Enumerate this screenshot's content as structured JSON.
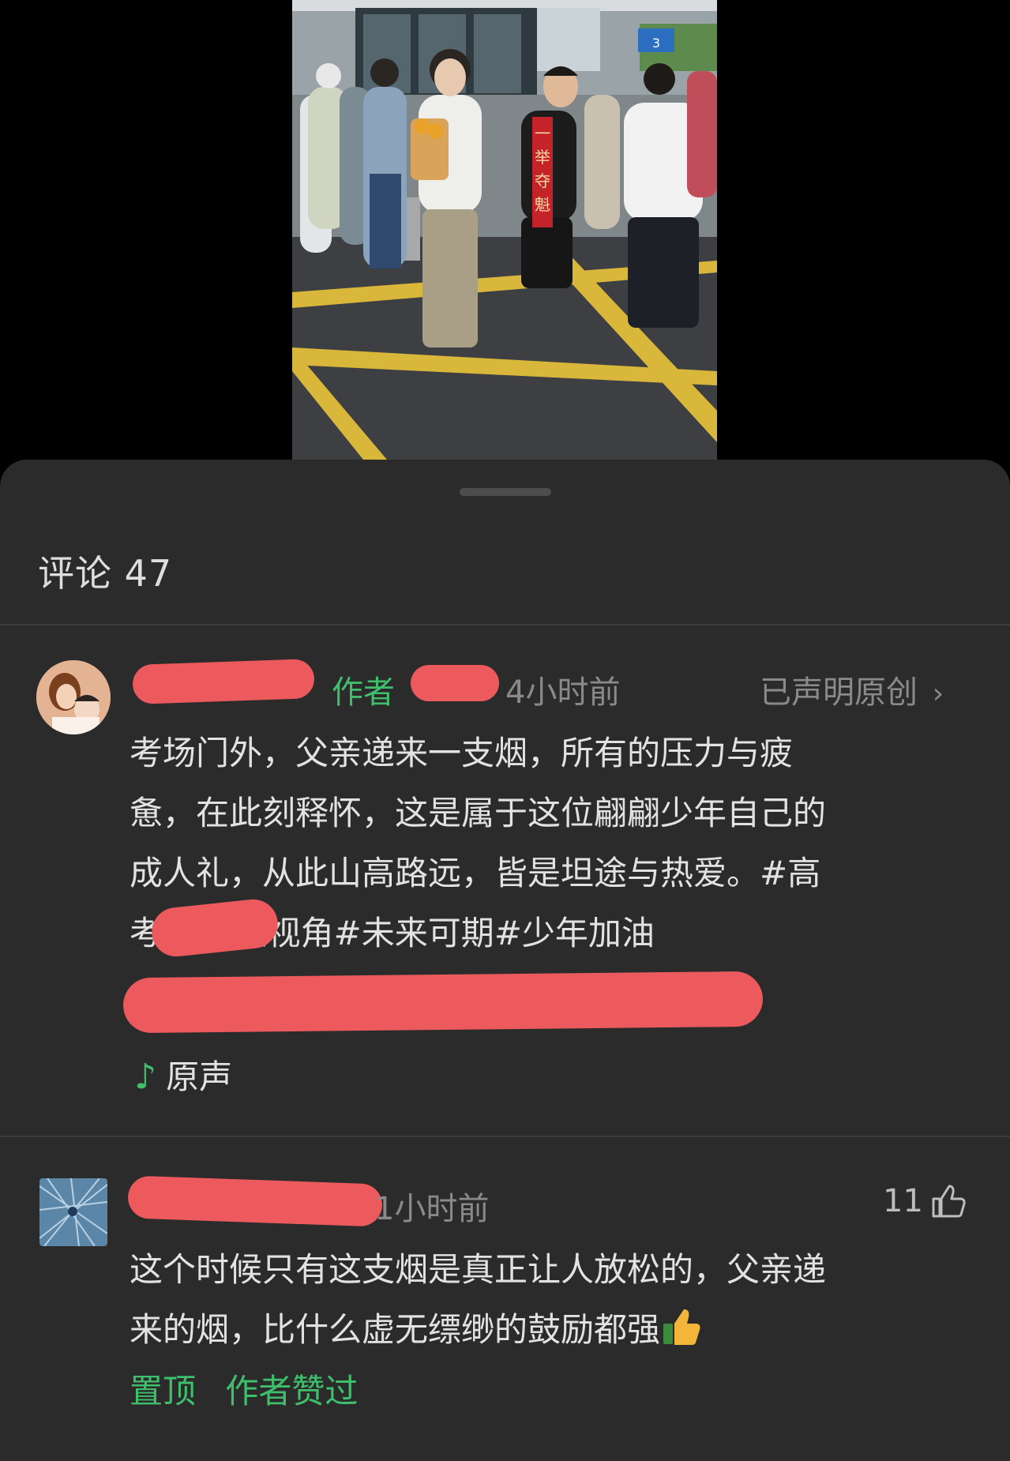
{
  "sheet": {
    "title": "评论 47"
  },
  "post": {
    "author_tag": "作者",
    "time": "4小时前",
    "original_declared": "已声明原创",
    "body_lines": [
      "考场门外，父亲递来一支烟，所有的压力与疲",
      "惫，在此刻释怀，这是属于这位翩翩少年自己的",
      "成人礼，从此山高路远，皆是坦途与热爱。#高",
      "考         #路人视角#未来可期#少年加油"
    ],
    "sound_label": "原声"
  },
  "video_overlay": {
    "banner_text": "一举夺魁",
    "sign_text": "3"
  },
  "comment": {
    "time": "1小时前",
    "like_count": "11",
    "body_lines": [
      "这个时候只有这支烟是真正让人放松的，父亲递",
      "来的烟，比什么虚无缥缈的鼓励都强"
    ],
    "tag_pinned": "置顶",
    "tag_liked_by_author": "作者赞过"
  },
  "colors": {
    "sheet_bg": "#2b2b2b",
    "accent_green": "#3fbf6b",
    "redaction_red": "#ec5a5d"
  }
}
